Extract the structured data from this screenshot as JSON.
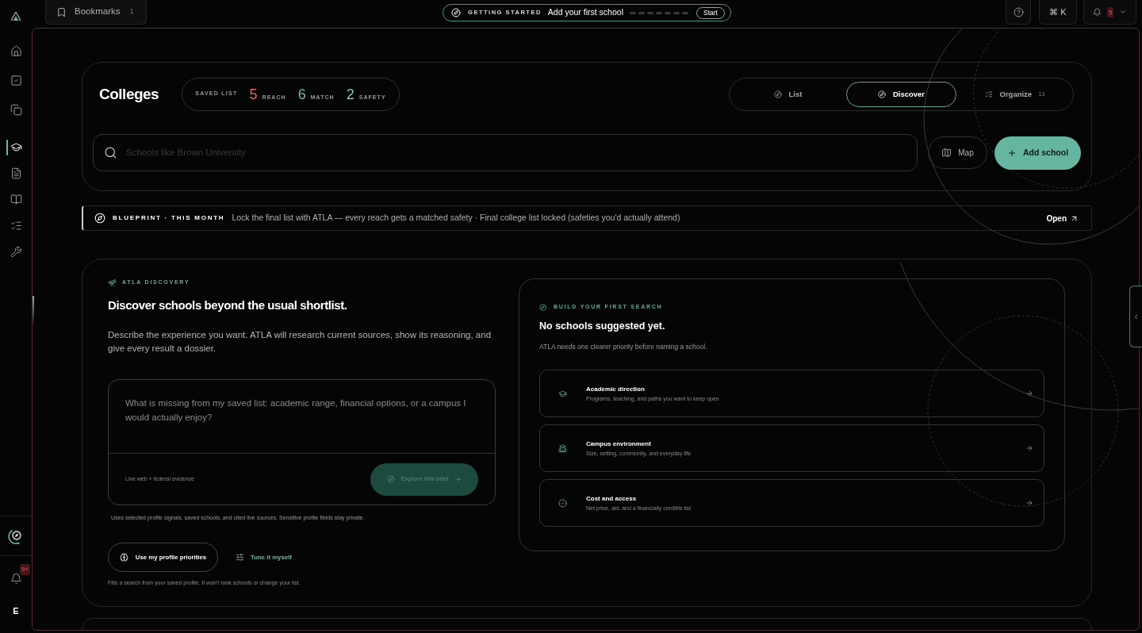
{
  "sidebar": {
    "nav": [
      {
        "selected": false
      },
      {
        "selected": false
      },
      {
        "selected": false
      },
      {
        "selected": true
      },
      {
        "selected": false
      },
      {
        "selected": false
      },
      {
        "selected": false
      },
      {
        "selected": false
      }
    ],
    "notifications": {
      "badge": "9+"
    },
    "account": {
      "initial": "E"
    }
  },
  "top_bar": {
    "bookmarks": {
      "label": "Bookmarks",
      "count": "1"
    },
    "getting_started": {
      "eyebrow": "GETTING STARTED",
      "task": "Add your first school",
      "steps": [
        {
          "done": false
        },
        {
          "done": false
        },
        {
          "done": false
        },
        {
          "done": false
        },
        {
          "done": false
        },
        {
          "done": false
        },
        {
          "done": false
        }
      ],
      "action": "Start"
    },
    "shortcut": "⌘ K",
    "notifications": {
      "count": "5"
    }
  },
  "colleges": {
    "title": "Colleges",
    "saved_list": {
      "label": "SAVED LIST",
      "stats": [
        {
          "value": "5",
          "label": "REACH",
          "color": "#d9685e"
        },
        {
          "value": "6",
          "label": "MATCH",
          "color": "#74b9a4"
        },
        {
          "value": "2",
          "label": "SAFETY",
          "color": "#8ec3b3"
        }
      ]
    },
    "tabs": [
      {
        "label": "List",
        "selected": false
      },
      {
        "label": "Discover",
        "selected": true
      },
      {
        "label": "Organize",
        "count": "13",
        "selected": false
      }
    ],
    "search": {
      "placeholder": "Schools like Brown University"
    },
    "map_button": "Map",
    "add_button": "Add school"
  },
  "blueprint": {
    "eyebrow": "BLUEPRINT · THIS MONTH",
    "text": "Lock the final list with ATLA — every reach gets a matched safety · Final college list locked (safeties you'd actually attend)",
    "action": "Open"
  },
  "discovery": {
    "eyebrow": "ATLA DISCOVERY",
    "title": "Discover schools beyond the usual shortlist.",
    "description": "Describe the experience you want. ATLA will research current sources, show its reasoning, and give every result a dossier.",
    "brief": {
      "placeholder": "What is missing from my saved list: academic range, financial options, or a campus I would actually enjoy?",
      "source_note": "Live web + federal evidence",
      "submit": {
        "label": "Explore this brief",
        "disabled": true
      }
    },
    "privacy_note": "Uses selected profile signals, saved schools, and cited live sources. Sensitive profile fields stay private.",
    "actions": [
      {
        "kind": "outlined",
        "label": "Use my profile priorities"
      },
      {
        "kind": "link",
        "label": "Tune it myself"
      }
    ],
    "footnote": "Fills a search from your saved profile. It won't rank schools or change your list.",
    "builder": {
      "eyebrow": "BUILD YOUR FIRST SEARCH",
      "title": "No schools suggested yet.",
      "subtitle": "ATLA needs one clearer priority before naming a school.",
      "priorities": [
        {
          "title": "Academic direction",
          "description": "Programs, teaching, and paths you want to keep open"
        },
        {
          "title": "Campus environment",
          "description": "Size, setting, community, and everyday life"
        },
        {
          "title": "Cost and access",
          "description": "Net price, aid, and a financially credible list"
        }
      ]
    }
  },
  "side_panel": {
    "expanded": false
  }
}
